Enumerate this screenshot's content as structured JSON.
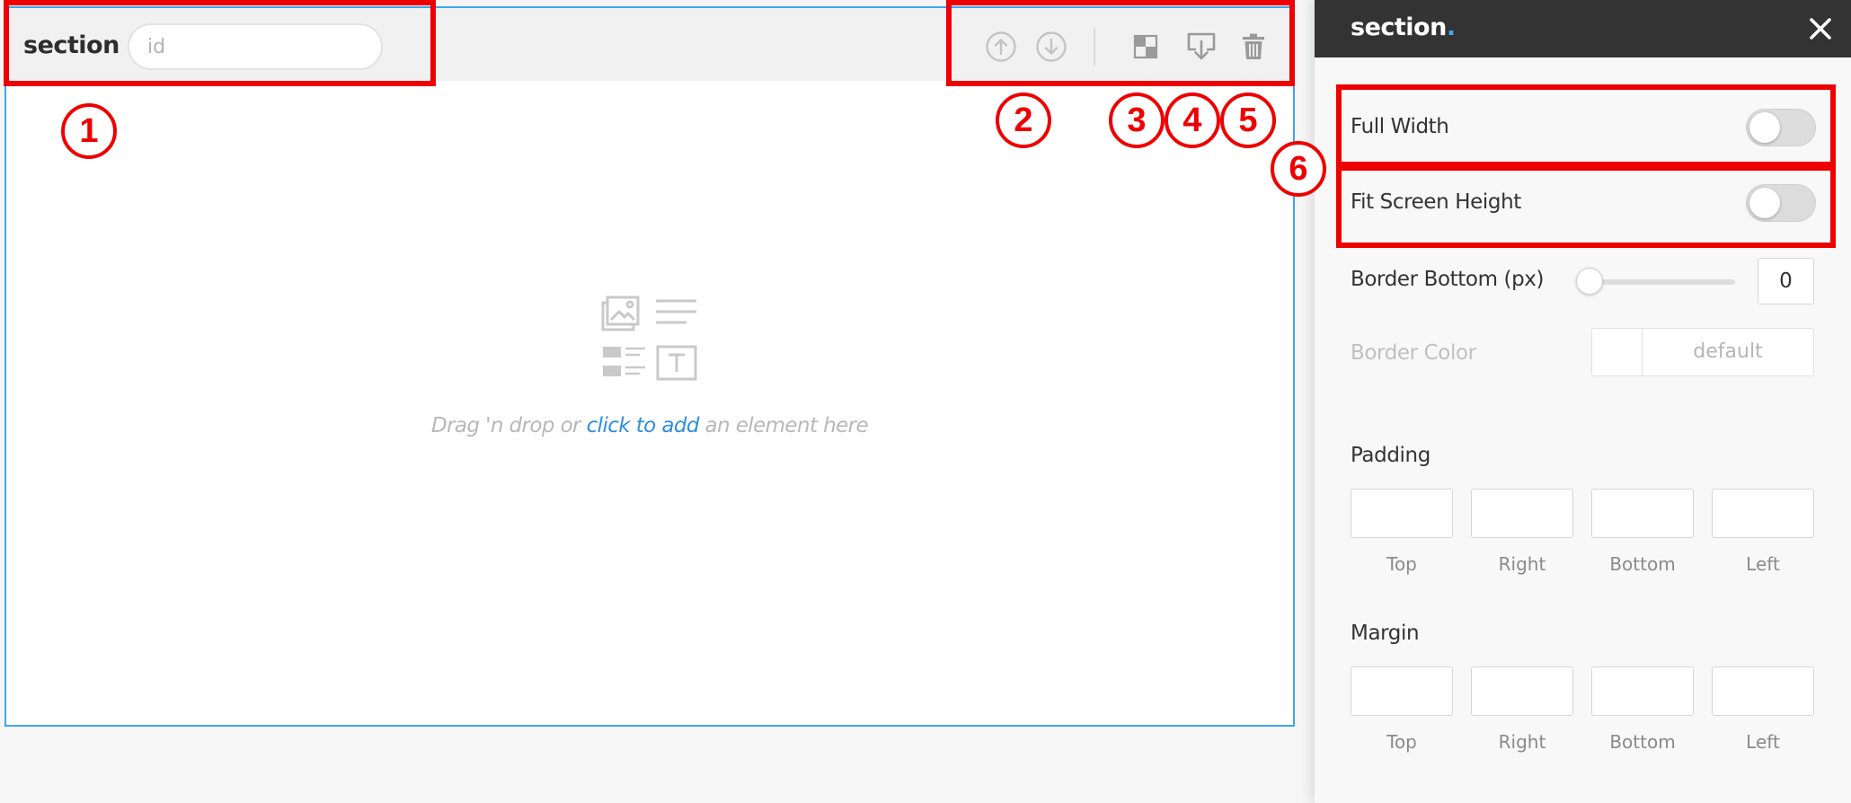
{
  "canvas": {
    "section_label": "section",
    "id_placeholder": "id",
    "toolbar": {
      "move_up": "arrow-up-circle-icon",
      "move_down": "arrow-down-circle-icon",
      "template": "layout-template-icon",
      "save": "download-save-icon",
      "delete": "trash-icon"
    },
    "placeholder": {
      "text_before": "Drag 'n drop or ",
      "link": "click to add",
      "text_after": " an element here"
    }
  },
  "panel": {
    "title": "section",
    "title_dot": ".",
    "full_width_label": "Full Width",
    "full_width_on": false,
    "fit_screen_label": "Fit Screen Height",
    "fit_screen_on": false,
    "border_bottom_label": "Border Bottom (px)",
    "border_bottom_value": "0",
    "border_color_label": "Border Color",
    "border_color_value": "default",
    "padding_label": "Padding",
    "margin_label": "Margin",
    "sides": [
      "Top",
      "Right",
      "Bottom",
      "Left"
    ]
  },
  "annotations": [
    "1",
    "2",
    "3",
    "4",
    "5",
    "6"
  ],
  "colors": {
    "accent": "#3ea6ee",
    "link": "#2f8ee0",
    "annotation": "#ee0000",
    "panel_header": "#333333"
  }
}
